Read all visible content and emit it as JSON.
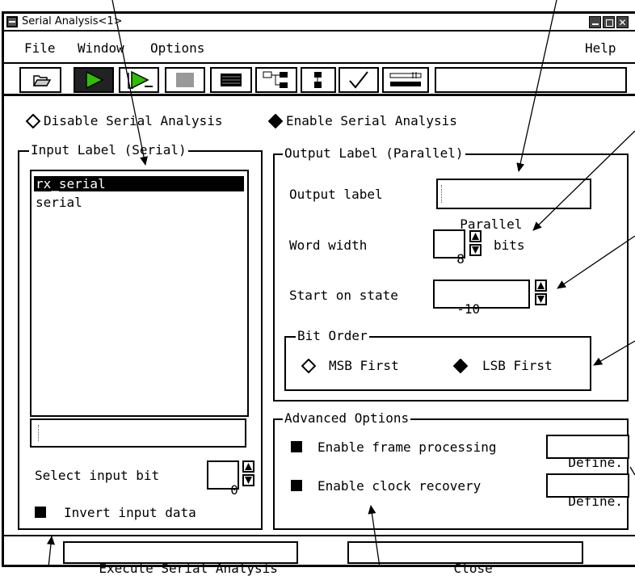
{
  "window": {
    "title": "Serial Analysis<1>",
    "controls": [
      "minimize-icon",
      "maximize-icon",
      "close-icon"
    ]
  },
  "menu": {
    "file": "File",
    "window": "Window",
    "options": "Options",
    "help": "Help"
  },
  "toolbar": {
    "icons": [
      "open-folder-icon",
      "run-icon",
      "run-repetitive-icon",
      "stop-icon",
      "listing-icon",
      "hierarchy-icon",
      "module-icon",
      "check-icon",
      "tool-icon"
    ],
    "status_text": ""
  },
  "mode": {
    "disable_label": "Disable Serial Analysis",
    "enable_label": "Enable Serial Analysis",
    "selected": "enable"
  },
  "input": {
    "group_title": "Input Label (Serial)",
    "labels": [
      "rx_serial",
      "serial"
    ],
    "selected_index": 0,
    "entry_value": "",
    "select_bit_label": "Select input bit",
    "select_bit_value": "0",
    "invert_label": "Invert input data",
    "invert_checked": true
  },
  "output": {
    "group_title": "Output Label (Parallel)",
    "label_caption": "Output label",
    "label_value": "Parallel",
    "word_width_caption": "Word width",
    "word_width_value": "8",
    "word_width_unit": "bits",
    "start_caption": "Start on state",
    "start_value": "-10",
    "bit_order": {
      "title": "Bit Order",
      "msb_label": "MSB First",
      "lsb_label": "LSB First",
      "selected": "lsb"
    }
  },
  "advanced": {
    "group_title": "Advanced Options",
    "frame_label": "Enable frame processing",
    "frame_checked": true,
    "frame_button": "Define.",
    "clock_label": "Enable clock recovery",
    "clock_checked": true,
    "clock_button": "Define."
  },
  "actions": {
    "execute_label": "Execute Serial Analysis",
    "close_label": "Close"
  }
}
